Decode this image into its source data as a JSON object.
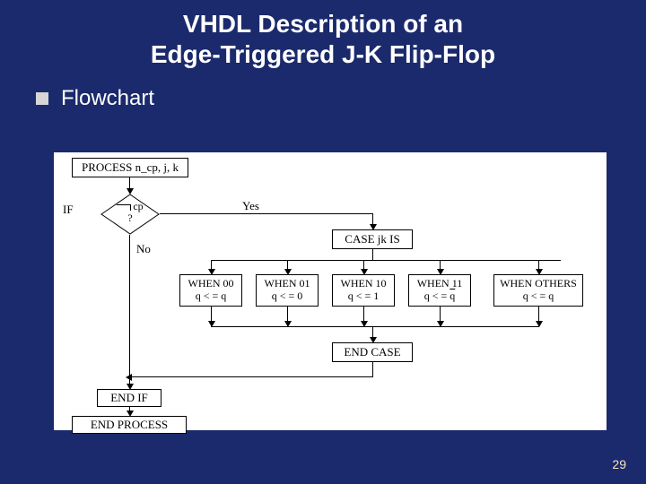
{
  "title_line1": "VHDL Description of an",
  "title_line2": "Edge-Triggered J-K Flip-Flop",
  "bullet_label": "Flowchart",
  "page_number": "29",
  "flow": {
    "process": "PROCESS n_cp, j, k",
    "if_label": "IF",
    "decision_top": "cp",
    "decision_q": "?",
    "no": "No",
    "yes": "Yes",
    "case": "CASE jk IS",
    "when00": {
      "head": "WHEN 00",
      "body": "q < = q"
    },
    "when01": {
      "head": "WHEN 01",
      "body": "q < = 0"
    },
    "when10": {
      "head": "WHEN 10",
      "body": "q < = 1"
    },
    "when11": {
      "head": "WHEN 11",
      "body": "q < = q̄"
    },
    "whenoth": {
      "head": "WHEN OTHERS",
      "body": "q < = q"
    },
    "endcase": "END CASE",
    "endif": "END IF",
    "endprocess": "END PROCESS"
  }
}
